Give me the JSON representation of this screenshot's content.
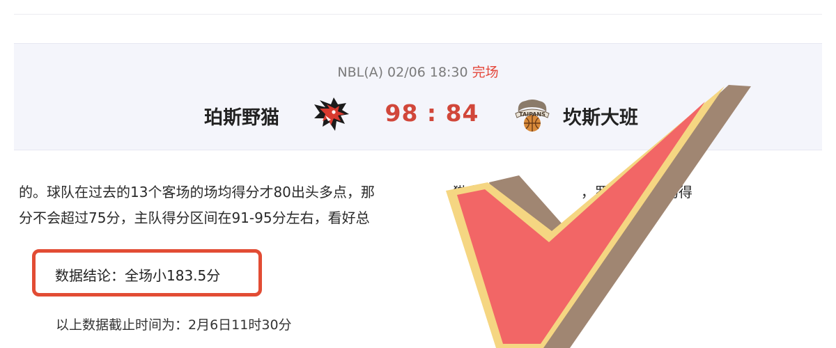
{
  "match": {
    "league_time": "NBL(A) 02/06 18:30",
    "status": "完场",
    "home_team": "珀斯野猫",
    "score": "98 : 84",
    "away_team": "坎斯大班",
    "away_logo_text": "TAIPANS"
  },
  "article": {
    "line1": "的。球队在过去的13个客场的场均得分才80出头多点，那",
    "line1_tail": "猫高强度",
    "line1_end": "，罗特认为这场得",
    "line2": "分不会超过75分，主队得分区间在91-95分左右，看好总"
  },
  "conclusion": {
    "text": "数据结论：全场小183.5分"
  },
  "footer": {
    "cutoff": "以上数据截止时间为：2月6日11时30分"
  },
  "colors": {
    "score": "#d1473a",
    "status": "#e4463a",
    "box_border": "#e24c34",
    "check_fill": "#f26666",
    "check_border": "#f5d682",
    "check_shadow": "#a08672"
  },
  "icons": {
    "home_logo": "wildcat-logo-icon",
    "away_logo": "taipans-snake-logo-icon",
    "overlay": "checkmark-icon"
  }
}
